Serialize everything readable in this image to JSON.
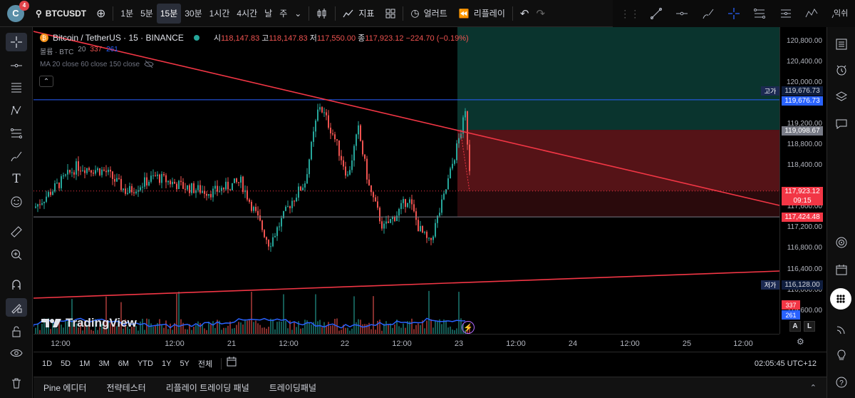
{
  "topbar": {
    "avatar_letter": "C",
    "notification_count": "4",
    "symbol": "BTCUSDT",
    "intervals": [
      "1분",
      "5분",
      "15분",
      "30분",
      "1시간",
      "4시간",
      "날",
      "주"
    ],
    "active_interval": "15분",
    "indicators_label": "지표",
    "alert_label": "얼러트",
    "replay_label": "리플레이"
  },
  "legend": {
    "title": "Bitcoin / TetherUS · 15 · BINANCE",
    "open_label": "시",
    "open": "118,147.83",
    "high_label": "고",
    "high": "118,147.83",
    "low_label": "저",
    "low": "117,550.00",
    "close_label": "종",
    "close": "117,923.12",
    "change": "−224.70 (−0.19%)",
    "volume_label": "볼륨 · BTC",
    "volume_len": "20",
    "volume_a": "337",
    "volume_b": "261",
    "ma_label": "MA 20 close 60 close 150 close"
  },
  "price_axis": {
    "ticks": [
      "120,800.00",
      "120,400.00",
      "120,000.00",
      "119,200.00",
      "118,800.00",
      "118,400.00",
      "117,600.00",
      "117,200.00",
      "116,800.00",
      "116,400.00",
      "116,000.00",
      "115,600.00"
    ],
    "high_tag_label": "고가",
    "high_tag": "119,676.73",
    "high_tag2": "119,676.73",
    "stop_tag": "119,098.67",
    "last_price": "117,923.12",
    "countdown": "09:15",
    "line_tag": "117,424.48",
    "low_tag_label": "저가",
    "low_tag": "116,128.00",
    "vol_tag_a": "337",
    "vol_tag_b": "261"
  },
  "time_axis": [
    "12:00",
    "12:00",
    "21",
    "12:00",
    "22",
    "12:00",
    "23",
    "12:00",
    "24",
    "12:00",
    "25",
    "12:00"
  ],
  "bottom_bar": {
    "ranges": [
      "1D",
      "5D",
      "1M",
      "3M",
      "6M",
      "YTD",
      "1Y",
      "5Y",
      "전체"
    ],
    "clock": "02:05:45 UTC+12",
    "auto_label": "A",
    "log_label": "L"
  },
  "bottom_panel": {
    "tabs": [
      "Pine 에디터",
      "전략테스터",
      "리플레이 트레이딩 패널",
      "트레이딩패널"
    ]
  },
  "brand": "TradingView",
  "right_edge_label": "익쉬",
  "colors": {
    "up": "#26a69a",
    "down": "#ef5350",
    "trendline": "#f23645",
    "level": "#2962ff",
    "profit_zone": "#0b3a33",
    "loss_zone": "#5a1418"
  }
}
